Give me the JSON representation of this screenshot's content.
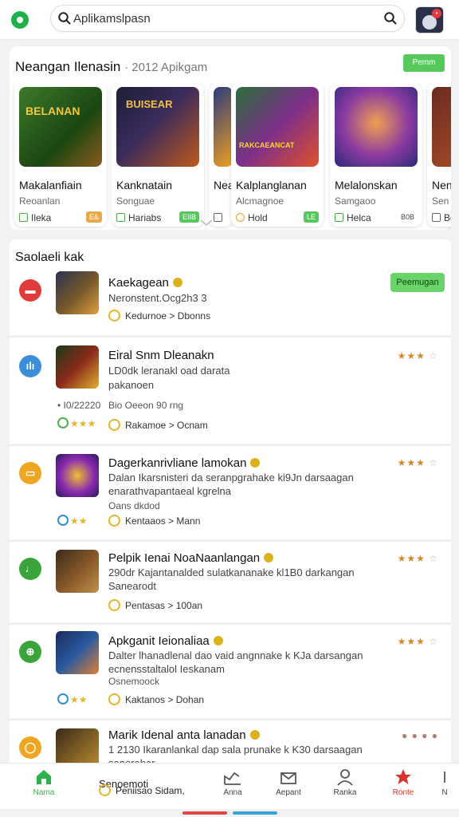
{
  "search": {
    "value": "Aplikamslpasn"
  },
  "featured": {
    "title": "Neangan Ilenasin",
    "subtitle": "· 2012 Apikgam",
    "cta": "Pemm",
    "cards": [
      {
        "art_label": "BELANAN",
        "name": "Makalanfiain",
        "sub": "Reoanlan",
        "meta": "Ileka",
        "pill": "E&",
        "pill_color": "#e9a94a"
      },
      {
        "art_label": "BUISEAR",
        "name": "Kanknatain",
        "sub": "Songuae",
        "meta": "Hariabs",
        "pill": "EIIB",
        "pill_color": "#56c95b"
      },
      {
        "art_label": "",
        "name": "Nea",
        "sub": "",
        "meta": "D",
        "pill": "",
        "pill_color": "#ffffff"
      },
      {
        "art_label": "RAKCAEANCAT",
        "name": "Kalplanglanan",
        "sub": "Alcmagnoe",
        "meta": "Hold",
        "pill": "LE",
        "pill_color": "#56c95b"
      },
      {
        "art_label": "",
        "name": "Melalonskan",
        "sub": "Samgaoo",
        "meta": "Helca",
        "pill": "B0B",
        "pill_color": "#ffffff"
      },
      {
        "art_label": "",
        "name": "Nen",
        "sub": "Sen",
        "meta": "Be",
        "pill": "",
        "pill_color": "#ffffff"
      }
    ]
  },
  "list": {
    "title": "Saolaeli kak",
    "rows": [
      {
        "title": "Kaekagean",
        "desc1": "Neronstent.Ocg2h3 3",
        "desc2": "",
        "extra": "",
        "rating": "Kedurnoe > Dbonns",
        "button": "Peemugan",
        "left_meta": "",
        "stars": "",
        "cat_color": "#e13a3a",
        "cat_glyph": "▬"
      },
      {
        "title": "Eiral Snm Dleanakn",
        "desc1": "LD0dk leranakl oad darata",
        "desc2": "pakanoen",
        "extra": "Bio Oeeon      90 rng",
        "rating": "Rakamoe > Ocnam",
        "left_meta": "• I0/22220",
        "stars": "★★★",
        "cat_color": "#3a8fd8",
        "cat_glyph": "ılı"
      },
      {
        "title": "Dagerkanrivliane lamokan",
        "desc1": "Dalan Ikarsnisteri da seranpgrahake ki9Jn darsaagan",
        "desc2": "enarathvapantaeal kgrelna",
        "extra": "Oans dkdod",
        "rating": "Kentaaos > Mann",
        "left_meta": "",
        "stars": "★★★",
        "cat_color": "#f0a623",
        "cat_glyph": "▭"
      },
      {
        "title": "Pelpik Ienai NoaNaanlangan",
        "desc1": "290dr Kajantanalded sulatkananake kl1B0 darkangan",
        "desc2": "Sanearodt",
        "extra": "",
        "rating": "Pentasas > 100an",
        "left_meta": "",
        "stars": "★★★",
        "cat_color": "#3aa33a",
        "cat_glyph": "♩"
      },
      {
        "title": "Apkganit Ieionaliaa",
        "desc1": "Dalter lhanadlenal dao vaid angnnake k KJa darsangan",
        "desc2": "ecnensstaltalol Ieskanam",
        "extra": "Osnemoock",
        "rating": "Kaktanos > Dohan",
        "left_meta": "",
        "stars": "★★★",
        "cat_color": "#3aa33a",
        "cat_glyph": "⊕"
      },
      {
        "title": "Marik Idenal anta lanadan",
        "desc1": "1 2130  Ikaranlankal dap sala prunake k K30 darsaagan",
        "desc2": "sanerahar",
        "extra": "Senoemoti",
        "rating": "Peniisao  Sidam,",
        "left_meta": "",
        "stars": "● ● ● ●",
        "cat_color": "#f0a623",
        "cat_glyph": "◯"
      }
    ]
  },
  "nav": {
    "items": [
      {
        "label": "Nama"
      },
      {
        "label": "Anna"
      },
      {
        "label": "Aepant"
      },
      {
        "label": "Ranka"
      },
      {
        "label": "Ronte"
      },
      {
        "label": "N"
      }
    ]
  },
  "colors": {
    "accent": "#1fb04a",
    "brand_green": "#56c95b",
    "active_nav": "#d9342b"
  }
}
